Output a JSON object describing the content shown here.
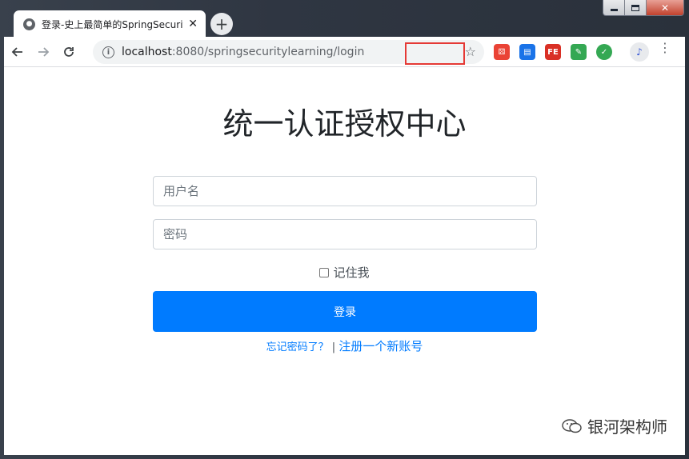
{
  "tab": {
    "title": "登录-史上最简单的SpringSecurity",
    "close": "✕"
  },
  "toolbar": {
    "url_host": "localhost",
    "url_rest": ":8080/springsecuritylearning/login"
  },
  "extensions": [
    {
      "icon": "dice-icon",
      "color": "#ea4335"
    },
    {
      "icon": "cast-icon",
      "color": "#1a73e8"
    },
    {
      "icon": "fe-icon",
      "color": "#d93025",
      "text": "FE"
    },
    {
      "icon": "puzzle-icon",
      "color": "#34a853"
    },
    {
      "icon": "check-icon",
      "color": "#34a853"
    }
  ],
  "page": {
    "title": "统一认证授权中心",
    "username_placeholder": "用户名",
    "password_placeholder": "密码",
    "remember_me": "记住我",
    "login_button": "登录",
    "forgot_password": "忘记密码了？",
    "separator": "|",
    "register": "注册一个新账号"
  },
  "watermark": {
    "text": "银河架构师"
  },
  "colors": {
    "primary": "#007bff",
    "highlight": "#e53935"
  }
}
